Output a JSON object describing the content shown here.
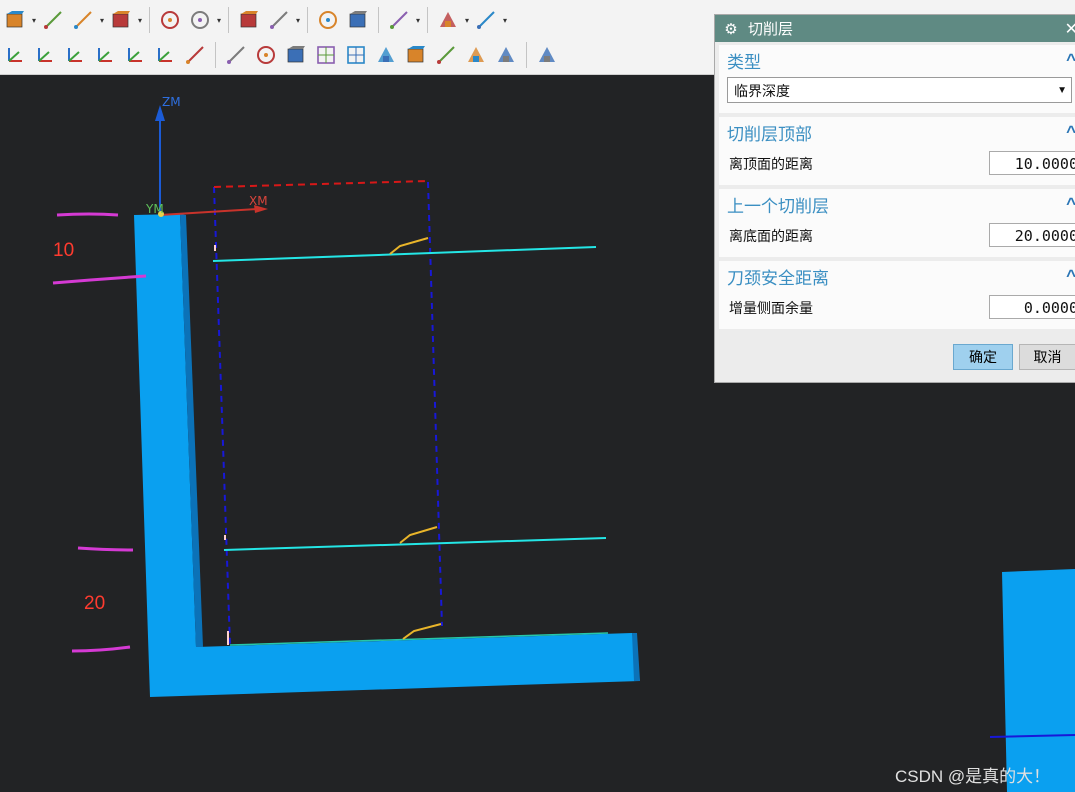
{
  "toolbar": {
    "row1_icons": [
      "cube-icon",
      "drop",
      "folder-icon",
      "surface-icon",
      "drop",
      "color-box-icon",
      "drop",
      "separator",
      "extrude-icon",
      "feature-icon",
      "drop",
      "separator",
      "layers-icon",
      "axis-icon",
      "drop",
      "separator",
      "edit-icon",
      "palette-icon",
      "separator",
      "view-icon",
      "drop",
      "separator",
      "section-icon",
      "drop",
      "measure-icon",
      "drop"
    ],
    "row2_icons": [
      "csys-icon",
      "csys-rotate-icon",
      "csys-origin-icon",
      "csys-xc-icon",
      "csys-yc-icon",
      "csys-edit-icon",
      "save-view-icon",
      "separator",
      "snap-point-icon",
      "line-icon",
      "segment-icon",
      "curve-icon",
      "arc-icon",
      "circle-point-icon",
      "circle-icon",
      "cross-icon",
      "diagonal-icon",
      "object-icon",
      "separator",
      "grid-icon"
    ]
  },
  "viewport": {
    "axis_zm": "ZM",
    "axis_xm": "XM",
    "axis_ym": "YM",
    "label_top": "10",
    "label_bottom": "20",
    "colors": {
      "part": "#0aa0f0",
      "level_line": "#24e6e6",
      "marker": "#e9b52a",
      "magenta": "#d53ad4",
      "blue_dash": "#1818d8",
      "red_dash": "#d81818"
    }
  },
  "dialog": {
    "title": "切削层",
    "sections": {
      "type": {
        "header": "类型",
        "select_value": "临界深度"
      },
      "top": {
        "header": "切削层顶部",
        "label": "离顶面的距离",
        "value": "10.0000"
      },
      "prev": {
        "header": "上一个切削层",
        "label": "离底面的距离",
        "value": "20.0000"
      },
      "tool": {
        "header": "刀颈安全距离",
        "label": "增量侧面余量",
        "value": "0.0000"
      }
    },
    "ok_label": "确定",
    "cancel_label": "取消"
  },
  "watermark": "CSDN @是真的大！"
}
